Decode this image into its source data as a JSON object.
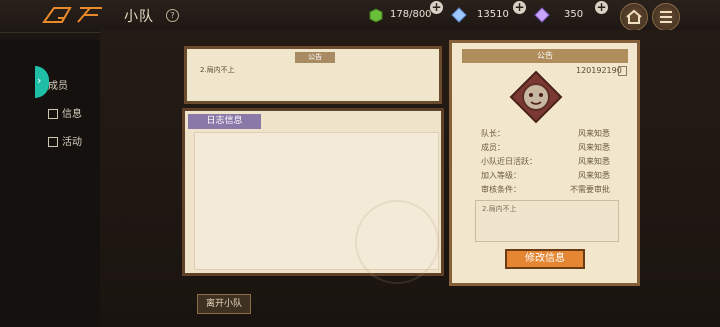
{
  "header": {
    "title": "小队",
    "help_symbol": "?",
    "resources": [
      {
        "name": "energy",
        "icon": "green-cube-icon",
        "value": "178/800"
      },
      {
        "name": "blue-crystal",
        "icon": "blue-crystal-icon",
        "value": "13510"
      },
      {
        "name": "purple-crystal",
        "icon": "purple-crystal-icon",
        "value": "350"
      }
    ],
    "plus_symbol": "+"
  },
  "sidebar": {
    "items": [
      {
        "label": "成员",
        "icon": "people-icon",
        "active": true
      },
      {
        "label": "信息",
        "icon": "info-icon",
        "active": false
      },
      {
        "label": "活动",
        "icon": "calendar-icon",
        "active": false
      }
    ]
  },
  "notice_panel": {
    "header": "公告",
    "text": "2.局内不上"
  },
  "log_panel": {
    "tab_label": "日志信息"
  },
  "leave_button": "离开小队",
  "info_card": {
    "header": "公告",
    "team_id": "120192190",
    "rows": [
      {
        "label": "队长：",
        "value": "风来知悉"
      },
      {
        "label": "成员：",
        "value": "风来知悉"
      },
      {
        "label": "小队近日活跃：",
        "value": "风来知悉"
      },
      {
        "label": "加入等级：",
        "value": "风来知悉"
      },
      {
        "label": "审核条件：",
        "value": "不需要审批"
      }
    ],
    "description": "2.局内不上",
    "edit_button": "修改信息"
  },
  "colors": {
    "accent_teal": "#1fbfa7",
    "edit_orange": "#e48632",
    "log_tab_purple": "#8a78a8"
  }
}
